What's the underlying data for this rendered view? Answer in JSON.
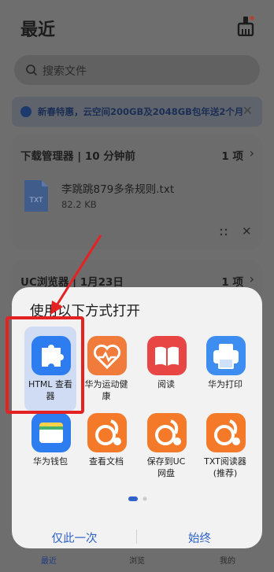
{
  "page": {
    "title": "最近",
    "search_placeholder": "搜索文件",
    "banner_text": "新春特惠，云空间200GB及2048GB包年送2个月",
    "banner_close": "✕"
  },
  "cards": [
    {
      "title": "下载管理器 | 10 分钟前",
      "count": "1 项",
      "file_name": "李跳跳879多条规则.txt",
      "file_size": "82.2 KB",
      "file_icon_text": "TXT"
    },
    {
      "title": "UC浏览器 | 1月23日",
      "count": "1 项"
    }
  ],
  "sheet": {
    "title": "使用以下方式打开",
    "apps": [
      {
        "label": "HTML 查看\n器",
        "icon": "puzzle-icon",
        "color": "#2e7df0"
      },
      {
        "label": "华为运动健\n康",
        "icon": "heart-icon",
        "color": "#f07b3a"
      },
      {
        "label": "阅读",
        "icon": "book-icon",
        "color": "#e84545"
      },
      {
        "label": "华为打印",
        "icon": "printer-icon",
        "color": "#3d8ef0"
      },
      {
        "label": "华为钱包",
        "icon": "wallet-icon",
        "color": "#2e7df0"
      },
      {
        "label": "查看文档",
        "icon": "uc-squirrel-icon",
        "color": "#f47a2a"
      },
      {
        "label": "保存到UC\n网盘",
        "icon": "uc-squirrel-icon",
        "color": "#f47a2a"
      },
      {
        "label": "TXT阅读器\n(推荐)",
        "icon": "uc-squirrel-icon",
        "color": "#f47a2a"
      }
    ],
    "once_label": "仅此一次",
    "always_label": "始终"
  },
  "bottom_nav": [
    "最近",
    "浏览",
    "我的"
  ],
  "colors": {
    "accent": "#2f63c9",
    "annotation": "#e52222"
  }
}
